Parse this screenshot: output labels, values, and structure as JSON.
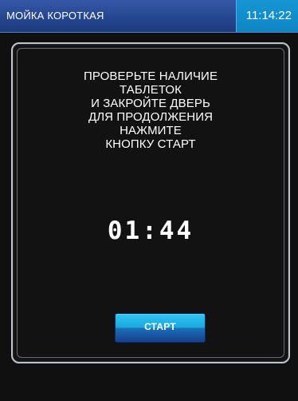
{
  "header": {
    "title": "МОЙКА КОРОТКАЯ",
    "clock": "11:14:22"
  },
  "dialog": {
    "message_lines": [
      "ПРОВЕРЬТЕ НАЛИЧИЕ",
      "ТАБЛЕТОК",
      "И ЗАКРОЙТЕ ДВЕРЬ",
      "ДЛЯ ПРОДОЛЖЕНИЯ",
      "НАЖМИТЕ",
      "КНОПКУ СТАРТ"
    ],
    "timer": "01:44",
    "start_button_label": "СТАРТ"
  },
  "colors": {
    "header_blue": "#25468f",
    "clock_blue": "#0d85c5",
    "background": "#101010",
    "button_blue": "#18a8de",
    "text": "#ffffff"
  }
}
